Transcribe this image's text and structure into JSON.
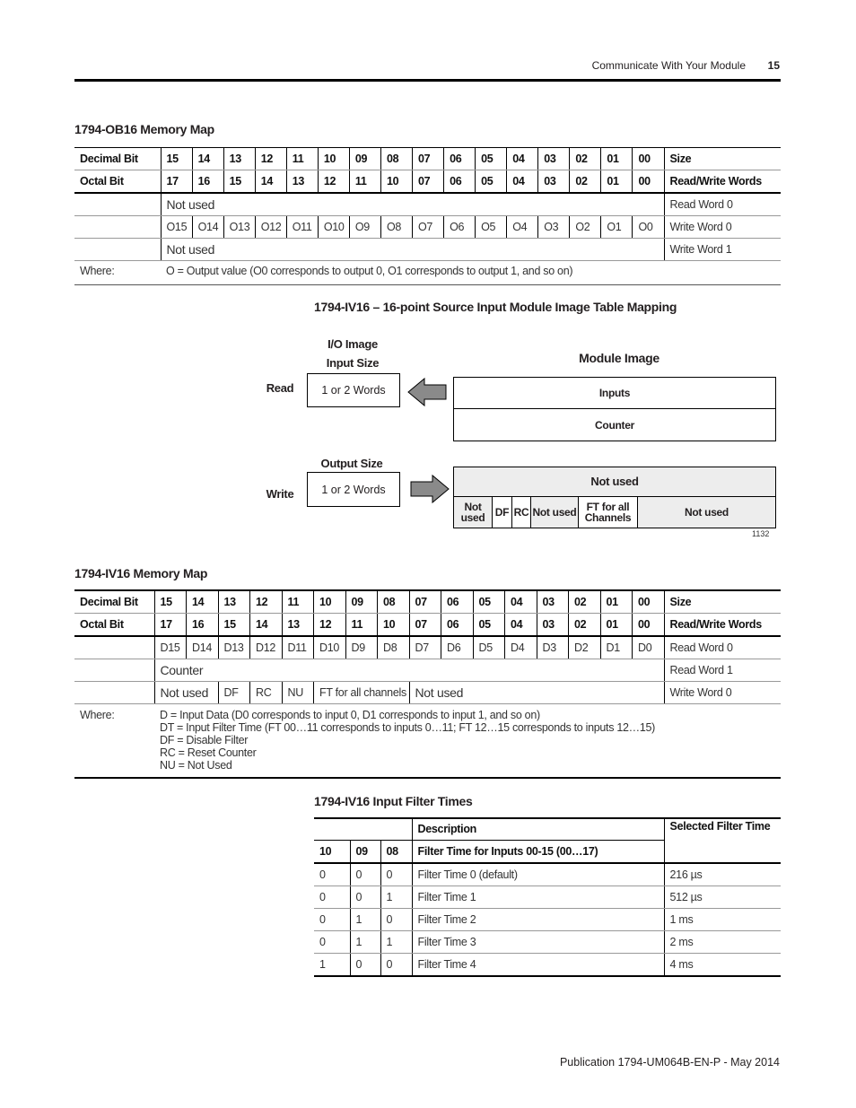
{
  "header": {
    "section": "Communicate With Your Module",
    "page": "15"
  },
  "ob16": {
    "title": "1794-OB16 Memory Map",
    "header_rows": [
      [
        "Decimal Bit",
        "15",
        "14",
        "13",
        "12",
        "11",
        "10",
        "09",
        "08",
        "07",
        "06",
        "05",
        "04",
        "03",
        "02",
        "01",
        "00",
        "Size"
      ],
      [
        "Octal Bit",
        "17",
        "16",
        "15",
        "14",
        "13",
        "12",
        "11",
        "10",
        "07",
        "06",
        "05",
        "04",
        "03",
        "02",
        "01",
        "00",
        "Read/Write Words"
      ]
    ],
    "rows": [
      {
        "label": "",
        "cells": [
          {
            "text": "Not used",
            "span": 16,
            "big": true
          }
        ],
        "size": "Read Word 0"
      },
      {
        "label": "",
        "cells": [
          {
            "text": "O15"
          },
          {
            "text": "O14"
          },
          {
            "text": "O13"
          },
          {
            "text": "O12"
          },
          {
            "text": "O11"
          },
          {
            "text": "O10"
          },
          {
            "text": "O9"
          },
          {
            "text": "O8"
          },
          {
            "text": "O7"
          },
          {
            "text": "O6"
          },
          {
            "text": "O5"
          },
          {
            "text": "O4"
          },
          {
            "text": "O3"
          },
          {
            "text": "O2"
          },
          {
            "text": "O1"
          },
          {
            "text": "O0"
          }
        ],
        "size": "Write Word 0"
      },
      {
        "label": "",
        "cells": [
          {
            "text": "Not used",
            "span": 16,
            "big": true
          }
        ],
        "size": "Write Word 1"
      }
    ],
    "where_label": "Where:",
    "where": [
      "O = Output value (O0 corresponds to output 0, O1 corresponds to output 1, and so on)"
    ]
  },
  "diagram": {
    "title": "1794-IV16 – 16-point Source Input Module Image Table Mapping",
    "io_image": "I/O Image",
    "input_size": "Input Size",
    "output_size": "Output Size",
    "read": "Read",
    "write": "Write",
    "read_box": "1 or 2 Words",
    "write_box": "1 or 2 Words",
    "module_image": "Module Image",
    "inputs": "Inputs",
    "counter": "Counter",
    "out_top": "Not used",
    "out_cells": [
      "Not used",
      "DF",
      "RC",
      "Not used",
      "FT for all Channels",
      "Not used"
    ],
    "figure_id": "1132",
    "arrow_color": "#8a8a8a",
    "shade_color": "#ededed"
  },
  "iv16": {
    "title": "1794-IV16 Memory Map",
    "header_rows": [
      [
        "Decimal Bit",
        "15",
        "14",
        "13",
        "12",
        "11",
        "10",
        "09",
        "08",
        "07",
        "06",
        "05",
        "04",
        "03",
        "02",
        "01",
        "00",
        "Size"
      ],
      [
        "Octal Bit",
        "17",
        "16",
        "15",
        "14",
        "13",
        "12",
        "11",
        "10",
        "07",
        "06",
        "05",
        "04",
        "03",
        "02",
        "01",
        "00",
        "Read/Write Words"
      ]
    ],
    "rows": [
      {
        "label": "",
        "cells": [
          {
            "text": "D15"
          },
          {
            "text": "D14"
          },
          {
            "text": "D13"
          },
          {
            "text": "D12"
          },
          {
            "text": "D11"
          },
          {
            "text": "D10"
          },
          {
            "text": "D9"
          },
          {
            "text": "D8"
          },
          {
            "text": "D7"
          },
          {
            "text": "D6"
          },
          {
            "text": "D5"
          },
          {
            "text": "D4"
          },
          {
            "text": "D3"
          },
          {
            "text": "D2"
          },
          {
            "text": "D1"
          },
          {
            "text": "D0"
          }
        ],
        "size": "Read Word 0"
      },
      {
        "label": "",
        "cells": [
          {
            "text": "Counter",
            "span": 16,
            "big": true
          }
        ],
        "size": "Read Word 1"
      },
      {
        "label": "",
        "cells": [
          {
            "text": "Not used",
            "span": 2,
            "big": true
          },
          {
            "text": "DF"
          },
          {
            "text": "RC"
          },
          {
            "text": "NU"
          },
          {
            "text": "FT for all channels",
            "span": 3
          },
          {
            "text": "Not used",
            "span": 8,
            "big": true
          }
        ],
        "size": "Write Word 0"
      }
    ],
    "where_label": "Where:",
    "where": [
      "D = Input Data (D0 corresponds to input 0, D1 corresponds to input 1, and so on)",
      "DT = Input Filter Time (FT 00…11 corresponds to inputs 0…11; FT 12…15 corresponds to inputs 12…15)",
      "DF = Disable Filter",
      "RC = Reset Counter",
      "NU = Not Used"
    ]
  },
  "filter": {
    "title": "1794-IV16 Input Filter Times",
    "description": "Description",
    "selected": "Selected Filter Time",
    "bits": [
      "10",
      "09",
      "08"
    ],
    "subheader": "Filter Time for Inputs 00-15 (00…17)",
    "rows": [
      {
        "b10": "0",
        "b09": "0",
        "b08": "0",
        "desc": "Filter Time 0 (default)",
        "time": "216 µs"
      },
      {
        "b10": "0",
        "b09": "0",
        "b08": "1",
        "desc": "Filter Time 1",
        "time": "512 µs"
      },
      {
        "b10": "0",
        "b09": "1",
        "b08": "0",
        "desc": "Filter Time 2",
        "time": "1 ms"
      },
      {
        "b10": "0",
        "b09": "1",
        "b08": "1",
        "desc": "Filter Time 3",
        "time": "2 ms"
      },
      {
        "b10": "1",
        "b09": "0",
        "b08": "0",
        "desc": "Filter Time 4",
        "time": "4 ms"
      }
    ]
  },
  "footer": {
    "publication": "Publication 1794-UM064B-EN-P - May 2014"
  }
}
